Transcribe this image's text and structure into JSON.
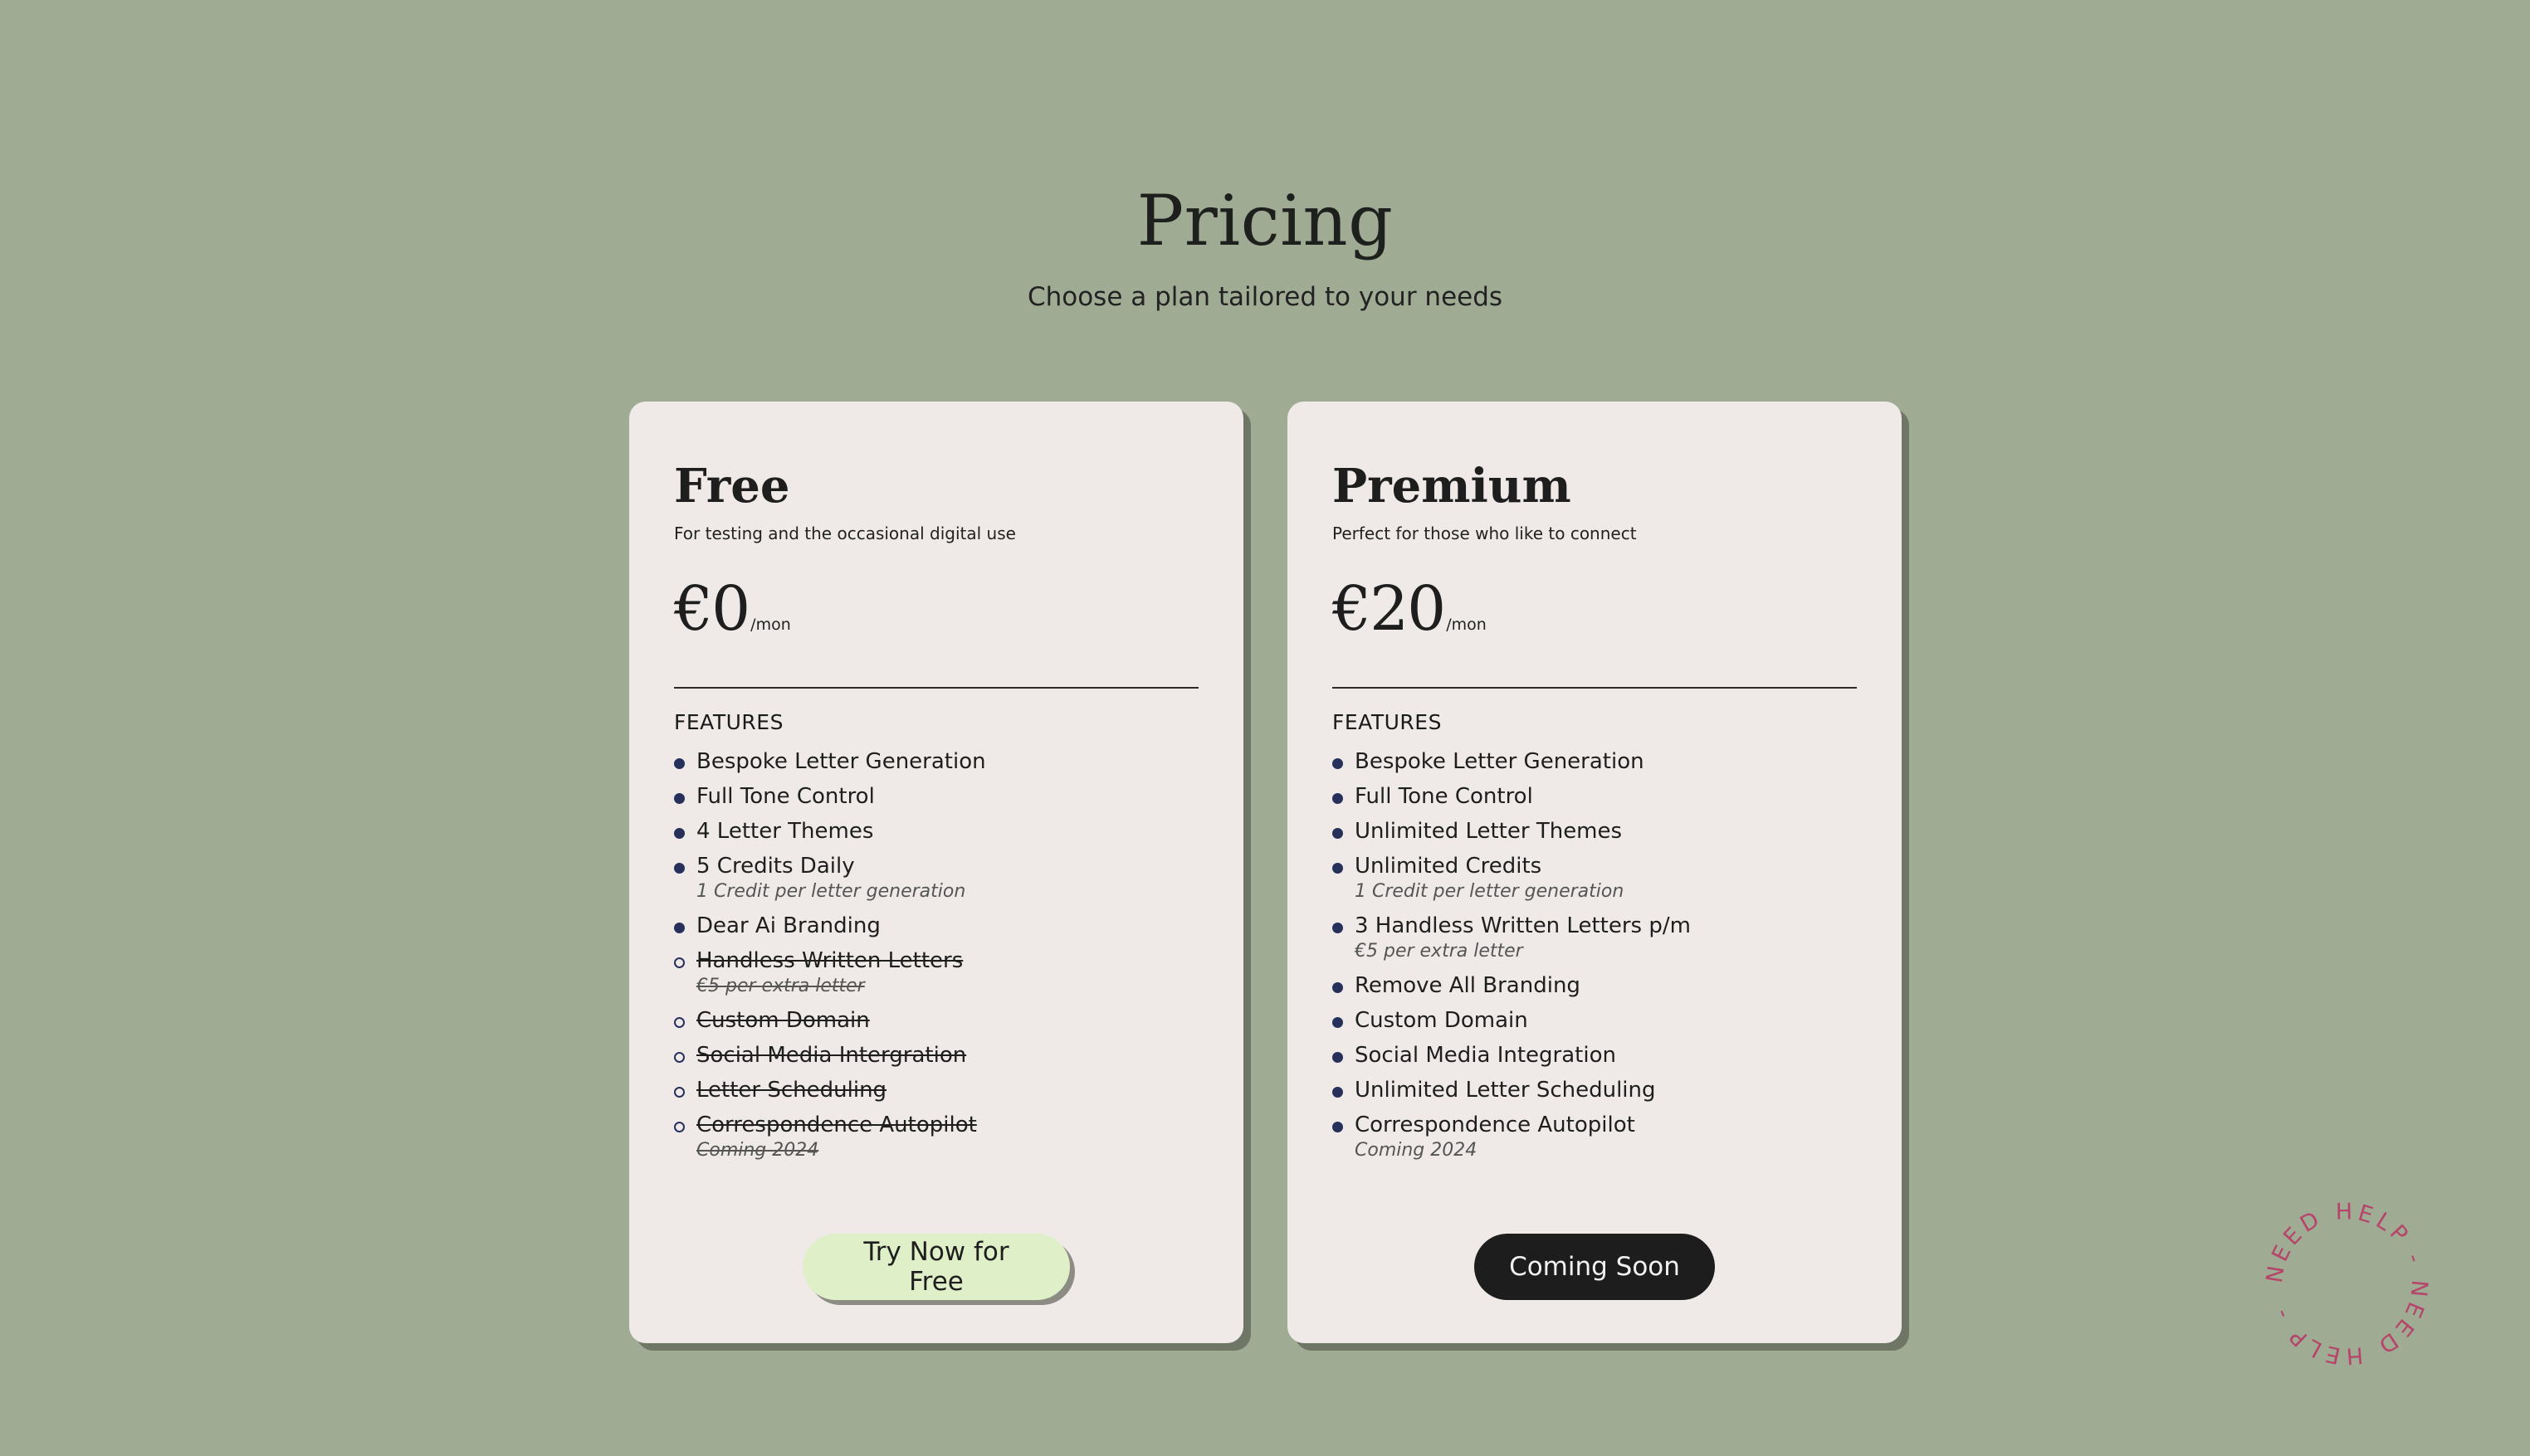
{
  "header": {
    "title": "Pricing",
    "subtitle": "Choose a plan tailored to your needs"
  },
  "plans": [
    {
      "name": "Free",
      "description": "For testing and the occasional digital use",
      "price": "€0",
      "period": "/mon",
      "features_title": "FEATURES",
      "features": [
        {
          "label": "Bespoke Letter Generation",
          "note": "",
          "enabled": true
        },
        {
          "label": "Full Tone Control",
          "note": "",
          "enabled": true
        },
        {
          "label": "4 Letter Themes",
          "note": "",
          "enabled": true
        },
        {
          "label": "5 Credits Daily",
          "note": "1 Credit per letter generation",
          "enabled": true
        },
        {
          "label": "Dear Ai Branding",
          "note": "",
          "enabled": true
        },
        {
          "label": "Handless Written Letters",
          "note": "€5 per extra letter",
          "enabled": false
        },
        {
          "label": "Custom Domain",
          "note": "",
          "enabled": false
        },
        {
          "label": "Social Media Intergration",
          "note": "",
          "enabled": false
        },
        {
          "label": "Letter Scheduling",
          "note": "",
          "enabled": false
        },
        {
          "label": "Correspondence Autopilot",
          "note": "Coming 2024",
          "enabled": false
        }
      ],
      "button_label": "Try Now for Free"
    },
    {
      "name": "Premium",
      "description": "Perfect for those who like to connect",
      "price": "€20",
      "period": "/mon",
      "features_title": "FEATURES",
      "features": [
        {
          "label": "Bespoke Letter Generation",
          "note": "",
          "enabled": true
        },
        {
          "label": "Full Tone Control",
          "note": "",
          "enabled": true
        },
        {
          "label": "Unlimited Letter Themes",
          "note": "",
          "enabled": true
        },
        {
          "label": "Unlimited Credits",
          "note": "1 Credit per letter generation",
          "enabled": true
        },
        {
          "label": "3 Handless Written Letters p/m",
          "note": "€5 per extra letter",
          "enabled": true
        },
        {
          "label": "Remove All Branding",
          "note": "",
          "enabled": true
        },
        {
          "label": "Custom Domain",
          "note": "",
          "enabled": true
        },
        {
          "label": "Social Media Integration",
          "note": "",
          "enabled": true
        },
        {
          "label": "Unlimited Letter Scheduling",
          "note": "",
          "enabled": true
        },
        {
          "label": "Correspondence Autopilot",
          "note": "Coming 2024",
          "enabled": true
        }
      ],
      "button_label": "Coming Soon"
    }
  ],
  "help_badge": {
    "text": "NEED HELP - NEED HELP - ",
    "color": "#b5456a",
    "icon": "help-badge-icon"
  },
  "colors": {
    "background": "#a0ab94",
    "card": "#efeae8",
    "bullet": "#27305a",
    "free_button": "#dfefc7",
    "soon_button": "#1d1d1d"
  }
}
